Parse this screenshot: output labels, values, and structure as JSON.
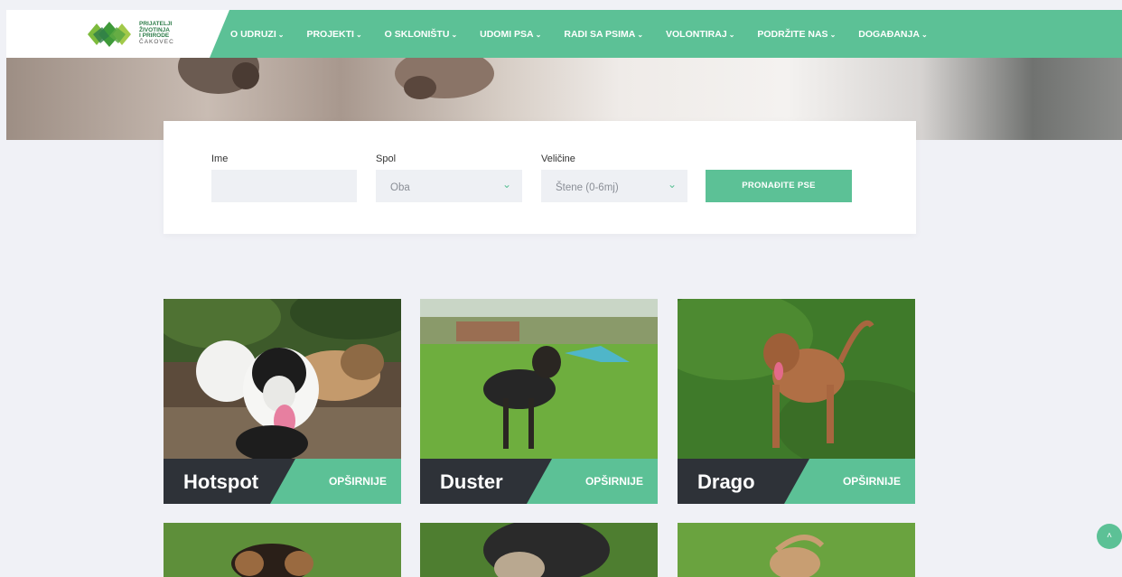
{
  "logo": {
    "line1": "PRIJATELJI",
    "line2": "ŽIVOTINJA",
    "line3": "I PRIRODE",
    "line4": "ČAKOVEC"
  },
  "nav": [
    {
      "label": "O UDRUZI"
    },
    {
      "label": "PROJEKTI"
    },
    {
      "label": "O SKLONIŠTU"
    },
    {
      "label": "UDOMI PSA"
    },
    {
      "label": "RADI SA PSIMA"
    },
    {
      "label": "VOLONTIRAJ"
    },
    {
      "label": "PODRŽITE NAS"
    },
    {
      "label": "DOGAĐANJA"
    }
  ],
  "nav_chevron": "⌄",
  "filter": {
    "name_label": "Ime",
    "name_value": "",
    "sex_label": "Spol",
    "sex_value": "Oba",
    "size_label": "Veličine",
    "size_value": "Štene (0-6mj)",
    "search_button": "PRONAĐITE PSE"
  },
  "dogs": [
    {
      "name": "Hotspot",
      "more": "OPŠIRNIJE"
    },
    {
      "name": "Duster",
      "more": "OPŠIRNIJE"
    },
    {
      "name": "Drago",
      "more": "OPŠIRNIJE"
    }
  ],
  "scroll_top_glyph": "˄",
  "colors": {
    "accent": "#5cc196",
    "dark": "#2e3238",
    "background": "#f0f1f6"
  }
}
